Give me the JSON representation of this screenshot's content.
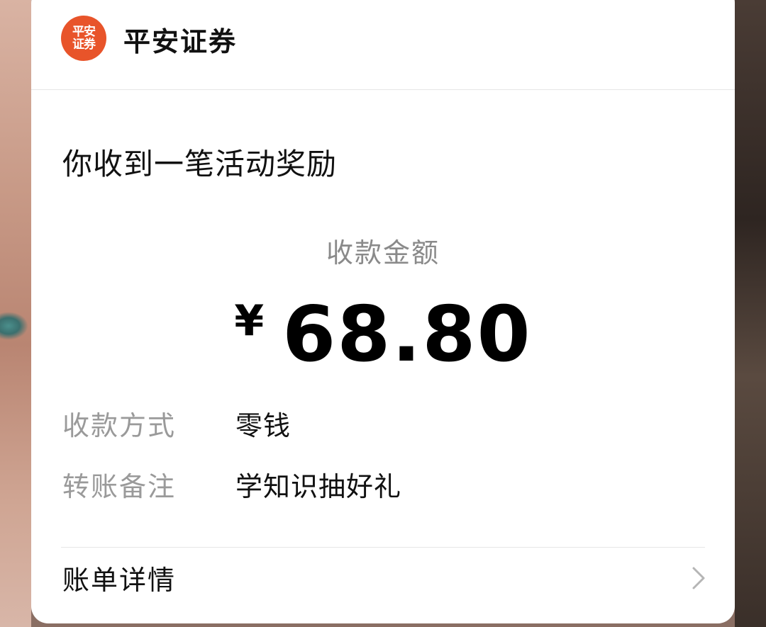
{
  "brand": {
    "logo_line1": "平安",
    "logo_line2": "证券",
    "name": "平安证券"
  },
  "notice": "你收到一笔活动奖励",
  "amount": {
    "label": "收款金额",
    "currency": "¥",
    "value": "68.80"
  },
  "details": [
    {
      "key": "收款方式",
      "value": "零钱"
    },
    {
      "key": "转账备注",
      "value": "学知识抽好礼"
    }
  ],
  "bill": {
    "label": "账单详情",
    "icon": "chevron-right-icon"
  },
  "colors": {
    "logo_bg": "#e8542a",
    "text_primary": "#111111",
    "text_secondary": "#9a9a9a"
  }
}
